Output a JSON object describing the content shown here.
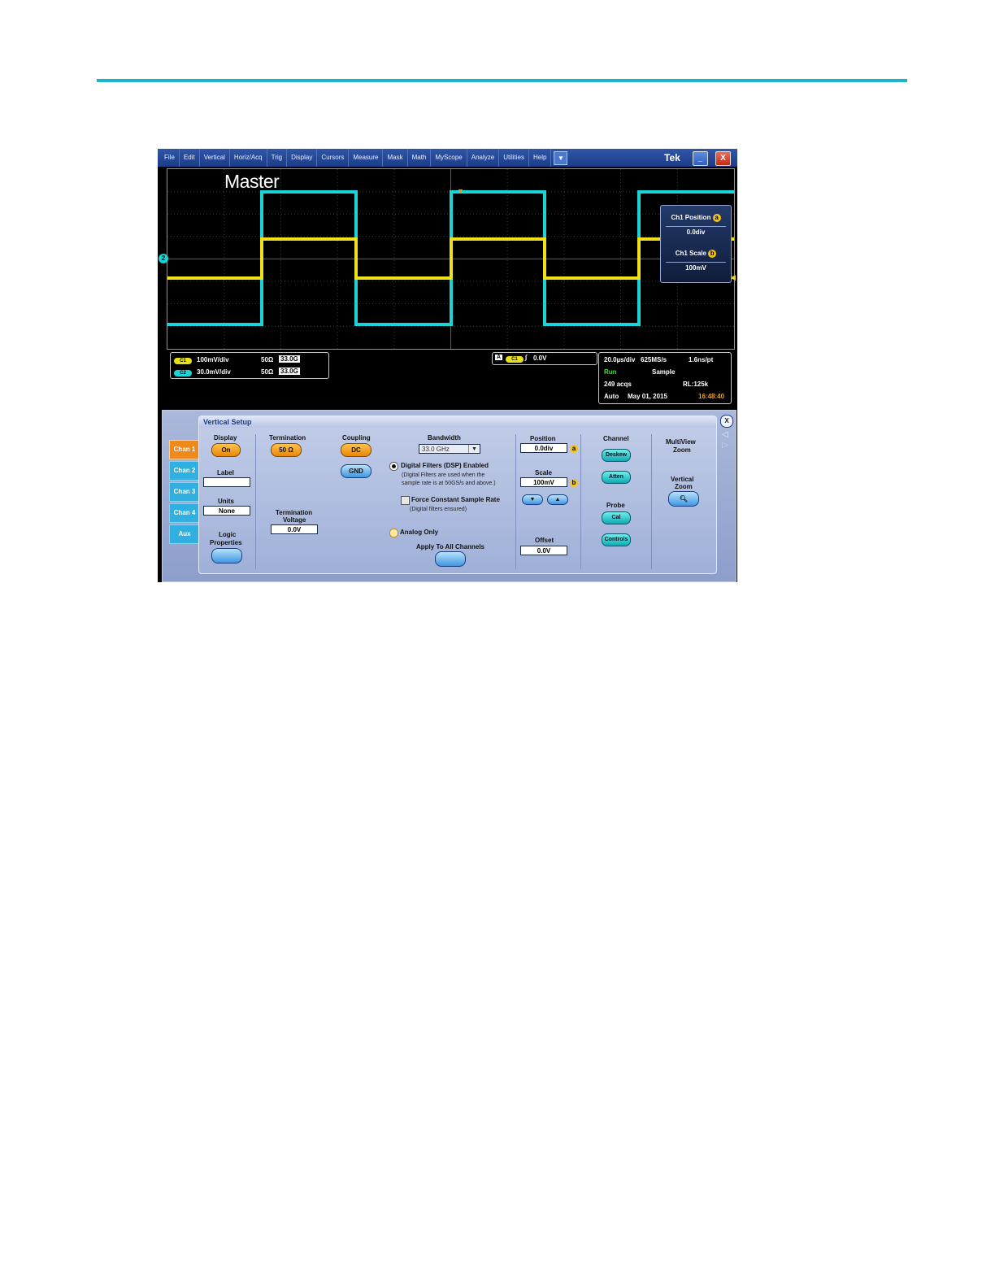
{
  "menubar": {
    "items": [
      "File",
      "Edit",
      "Vertical",
      "Horiz/Acq",
      "Trig",
      "Display",
      "Cursors",
      "Measure",
      "Mask",
      "Math",
      "MyScope",
      "Analyze",
      "Utilities",
      "Help"
    ],
    "dropdown_icon": "chevron-down-icon",
    "brand": "Tek",
    "minimize": "_",
    "close": "X"
  },
  "screen": {
    "title": "Master",
    "ground_marker": "2",
    "trace_colors": {
      "ch1": "#f0e21a",
      "ch2": "#1ad4d8"
    }
  },
  "readout": {
    "position_label": "Ch1 Position",
    "position_badge": "a",
    "position_value": "0.0div",
    "scale_label": "Ch1 Scale",
    "scale_badge": "b",
    "scale_value": "100mV"
  },
  "status": {
    "ch1": {
      "pill": "C1",
      "scale": "100mV/div",
      "impedance": "50Ω",
      "bw": "33.0G"
    },
    "ch2": {
      "pill": "C2",
      "scale": "30.0mV/div",
      "impedance": "50Ω",
      "bw": "33.0G"
    },
    "trigger": {
      "letter": "A",
      "source": "C1",
      "level": "0.0V"
    },
    "acq": {
      "timebase": "20.0µs/div",
      "rate": "625MS/s",
      "resolution": "1.6ns/pt",
      "state": "Run",
      "mode": "Sample",
      "acqs": "249 acqs",
      "record": "RL:125k",
      "trigger_mode": "Auto",
      "date": "May 01, 2015",
      "time": "16:48:40"
    }
  },
  "side_tabs": [
    "Chan 1",
    "Chan 2",
    "Chan 3",
    "Chan 4",
    "Aux"
  ],
  "dialog": {
    "title": "Vertical Setup",
    "display_label": "Display",
    "display_value": "On",
    "label_label": "Label",
    "label_value": "",
    "units_label": "Units",
    "units_value": "None",
    "logic_label_1": "Logic",
    "logic_label_2": "Properties",
    "termination_label": "Termination",
    "termination_value": "50 Ω",
    "term_voltage_label_1": "Termination",
    "term_voltage_label_2": "Voltage",
    "term_voltage_value": "0.0V",
    "coupling_label": "Coupling",
    "coupling_dc": "DC",
    "coupling_gnd": "GND",
    "bandwidth_label": "Bandwidth",
    "bandwidth_value": "33.0 GHz",
    "dsp_label": "Digital Filters (DSP) Enabled",
    "dsp_note_1": "(Digital Filters are used when the",
    "dsp_note_2": "sample rate is at 50GS/s and above.)",
    "force_label": "Force Constant Sample Rate",
    "force_note": "(Digital filters ensured)",
    "analog_label": "Analog Only",
    "apply_label": "Apply To All Channels",
    "position_label": "Position",
    "position_value": "0.0div",
    "position_badge": "a",
    "scale_label": "Scale",
    "scale_value": "100mV",
    "scale_badge": "b",
    "offset_label": "Offset",
    "offset_value": "0.0V",
    "channel_label": "Channel",
    "deskew": "Deskew",
    "atten": "Atten",
    "probe_label": "Probe",
    "cal": "Cal",
    "controls": "Controls",
    "multiview_label_1": "MultiView",
    "multiview_label_2": "Zoom",
    "vzoom_label_1": "Vertical",
    "vzoom_label_2": "Zoom",
    "close": "X"
  }
}
